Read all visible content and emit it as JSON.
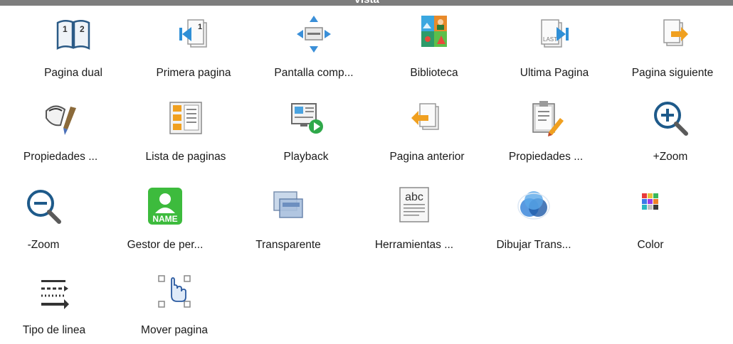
{
  "window": {
    "title": "Vista"
  },
  "tools": [
    {
      "label": "Pagina dual",
      "icon": "dual-page-book-icon"
    },
    {
      "label": "Primera pagina",
      "icon": "first-page-icon"
    },
    {
      "label": "Pantalla comp...",
      "icon": "fullscreen-icon"
    },
    {
      "label": "Biblioteca",
      "icon": "library-icon"
    },
    {
      "label": "Ultima Pagina",
      "icon": "last-page-icon"
    },
    {
      "label": "Pagina siguiente",
      "icon": "next-page-icon"
    },
    {
      "label": "Propiedades ...",
      "icon": "paint-properties-icon"
    },
    {
      "label": "Lista de paginas",
      "icon": "page-list-icon"
    },
    {
      "label": "Playback",
      "icon": "playback-icon"
    },
    {
      "label": "Pagina anterior",
      "icon": "previous-page-icon"
    },
    {
      "label": "Propiedades ...",
      "icon": "clipboard-properties-icon"
    },
    {
      "label": "+Zoom",
      "icon": "zoom-in-icon"
    },
    {
      "label": "-Zoom",
      "icon": "zoom-out-icon"
    },
    {
      "label": "Gestor de per...",
      "icon": "profile-manager-icon",
      "icon_text": "NAME"
    },
    {
      "label": "Transparente",
      "icon": "transparent-icon"
    },
    {
      "label": "Herramientas ...",
      "icon": "text-tools-icon",
      "icon_text": "abc"
    },
    {
      "label": "Dibujar Trans...",
      "icon": "draw-transparent-icon"
    },
    {
      "label": "Color",
      "icon": "color-palette-icon"
    },
    {
      "label": "Tipo de linea",
      "icon": "line-type-icon"
    },
    {
      "label": "Mover pagina",
      "icon": "move-page-icon"
    }
  ]
}
